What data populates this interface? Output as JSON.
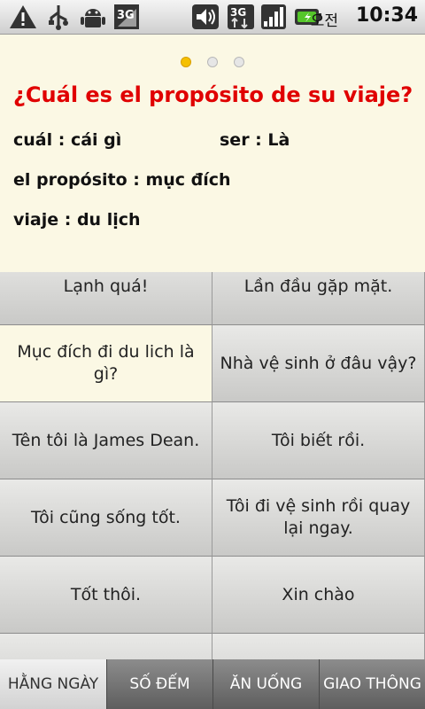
{
  "status_bar": {
    "ampm": "오전",
    "time": "10:34",
    "network": "3G",
    "icons": [
      "warning-icon",
      "usb-icon",
      "android-debug-icon",
      "3g-icon",
      "volume-icon",
      "3g-data-icon",
      "signal-icon",
      "battery-icon"
    ]
  },
  "card": {
    "question": "¿Cuál es el propósito de su viaje?",
    "vocab": [
      {
        "text": "cuál : cái gì"
      },
      {
        "text": "ser : Là"
      },
      {
        "text": "el propósito : mục đích"
      },
      {
        "text": "viaje : du lịch"
      }
    ],
    "page_dots": 3,
    "active_dot": 1
  },
  "phrases": [
    [
      "Lạnh quá!",
      "Lần đầu gặp mặt."
    ],
    [
      "Mục đích đi du lich là gì?",
      "Nhà vệ sinh ở đâu vậy?"
    ],
    [
      "Tên tôi là James Dean.",
      "Tôi biết rồi."
    ],
    [
      "Tôi cũng sống tốt.",
      "Tôi đi vệ sinh rồi quay lại ngay."
    ],
    [
      "Tốt thôi.",
      "Xin chào"
    ],
    [
      "",
      ""
    ]
  ],
  "tabs": [
    {
      "label": "HẰNG NGÀY",
      "active": true
    },
    {
      "label": "SỐ ĐẾM",
      "active": false
    },
    {
      "label": "ĂN UỐNG",
      "active": false
    },
    {
      "label": "GIAO THÔNG",
      "active": false
    }
  ],
  "colors": {
    "question": "#e00000",
    "card_bg": "#fbf8e4",
    "dot_active": "#f5c000"
  }
}
